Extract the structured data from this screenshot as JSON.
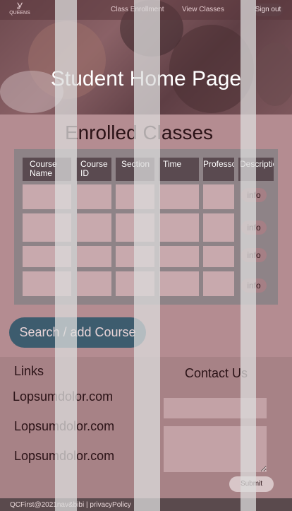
{
  "nav": {
    "logo_text": "QUEENS",
    "links": [
      "Class Enrollment",
      "View Classes"
    ],
    "signout": "Sign out"
  },
  "hero": {
    "title": "Student Home Page"
  },
  "enrolled": {
    "title": "Enrolled Classes",
    "headers": [
      "Course Name",
      "Course ID",
      "Section",
      "Time",
      "Professor",
      "Description"
    ],
    "info_label": "info"
  },
  "search": {
    "label": "Search / add Course"
  },
  "footer": {
    "links_title": "Links",
    "links": [
      "Lopsumdolor.com",
      "Lopsumdolor.com",
      "Lopsumdolor.com"
    ],
    "contact_title": "Contact Us",
    "submit": "Submit",
    "copyright": "QCFirst@2021nav&bibi | privacyPolicy"
  },
  "colors": {
    "background": "#b48c91",
    "accent": "#3d5c6e",
    "footer": "#a78286"
  }
}
